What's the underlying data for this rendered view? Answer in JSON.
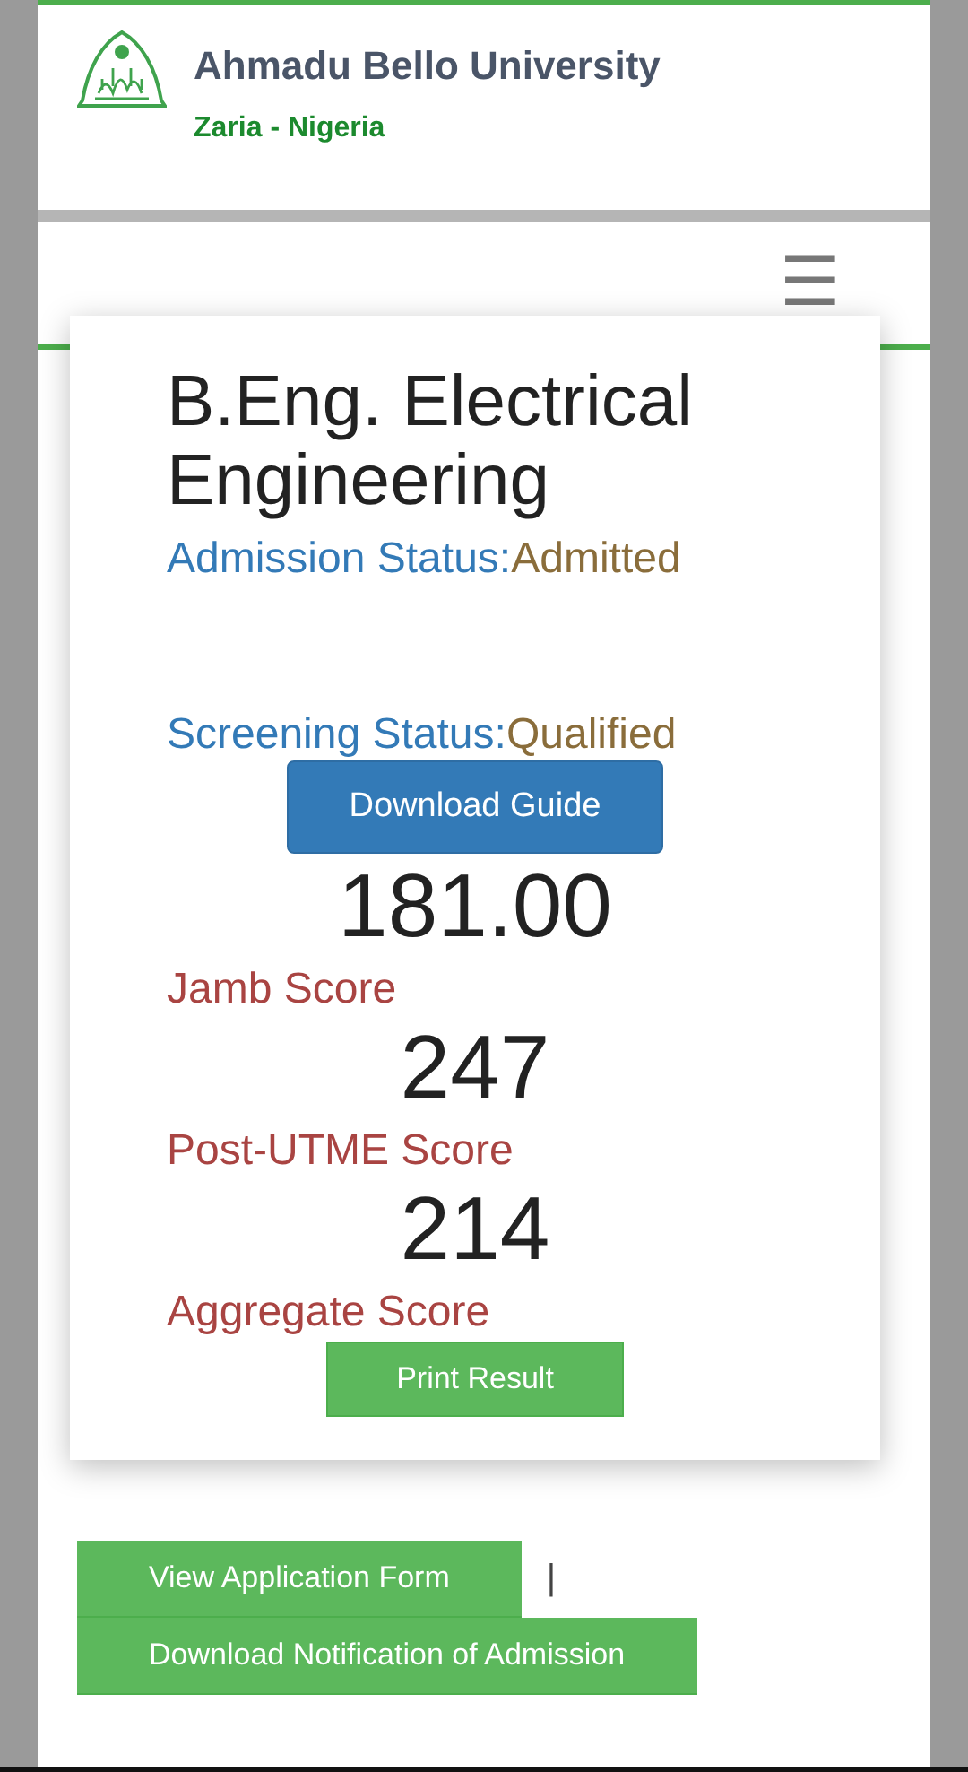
{
  "header": {
    "title": "Ahmadu Bello University",
    "subtitle": "Zaria - Nigeria"
  },
  "nav": {
    "menu_icon": "☰"
  },
  "result": {
    "programme": "B.Eng. Electrical Engineering",
    "statuses": [
      {
        "label": "Admission Status:",
        "value": "Admitted"
      },
      {
        "label": "Screening Status:",
        "value": "Qualified"
      }
    ],
    "guide_button": "Download Guide",
    "scores": [
      {
        "value": "181.00",
        "label": "Jamb Score"
      },
      {
        "value": "247",
        "label": "Post-UTME Score"
      },
      {
        "value": "214",
        "label": "Aggregate Score"
      }
    ],
    "print_button": "Print Result"
  },
  "actions": {
    "view_form": "View Application Form",
    "separator": "|",
    "notification": "Download Notification of Admission"
  }
}
